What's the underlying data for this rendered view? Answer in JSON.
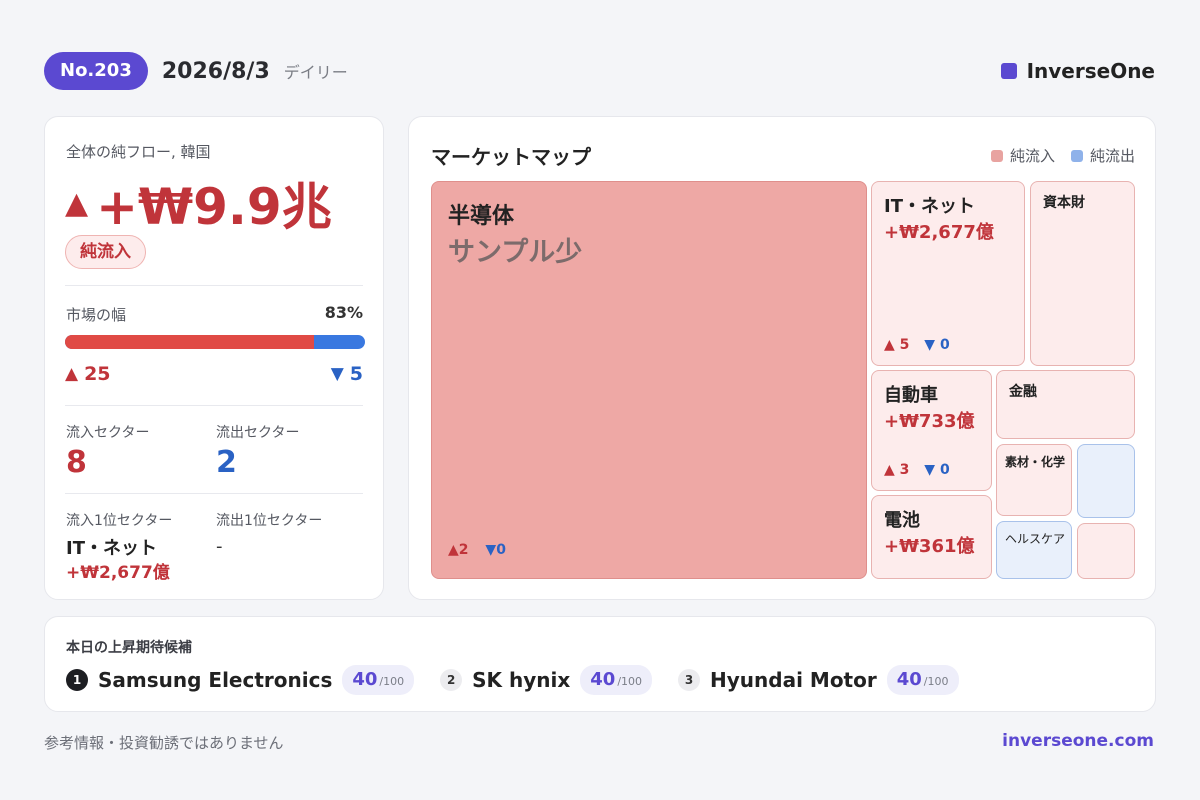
{
  "header": {
    "issue": "No.203",
    "date": "2026/8/3",
    "kind": "デイリー",
    "brand": "InverseOne",
    "brand_color": "#5b49d1"
  },
  "summary": {
    "flow_label": "全体の純フロー, 韓国",
    "flow_value": "+₩9.9兆",
    "flow_arrow": "▲",
    "flow_status": "純流入",
    "breadth_label": "市場の幅",
    "breadth_pct": "83%",
    "breadth_fraction": 0.83,
    "up_count": "25",
    "down_count": "5",
    "inflow_sectors_label": "流入セクター",
    "inflow_sectors": "8",
    "outflow_sectors_label": "流出セクター",
    "outflow_sectors": "2",
    "top_inflow_label": "流入1位セクター",
    "top_inflow_name": "IT・ネット",
    "top_inflow_value": "+₩2,677億",
    "top_outflow_label": "流出1位セクター",
    "top_outflow_name": "-"
  },
  "market_map": {
    "title": "マーケットマップ",
    "legend_inflow": "純流入",
    "legend_outflow": "純流出",
    "inflow_color": "#e8a3a0",
    "outflow_color": "#8fb2ea",
    "tiles": {
      "semis": {
        "name": "半導体",
        "note": "サンプル少",
        "up": "2",
        "down": "0"
      },
      "it": {
        "name": "IT・ネット",
        "value": "+₩2,677億",
        "up": "5",
        "down": "0"
      },
      "capital": {
        "name": "資本財"
      },
      "auto": {
        "name": "自動車",
        "value": "+₩733億",
        "up": "3",
        "down": "0"
      },
      "finance": {
        "name": "金融"
      },
      "battery": {
        "name": "電池",
        "value": "+₩361億"
      },
      "materials": {
        "name": "素材・化学"
      },
      "health": {
        "name": "ヘルスケア"
      }
    }
  },
  "candidates": {
    "title": "本日の上昇期待候補",
    "denom": "/100",
    "items": [
      {
        "rank": "1",
        "name": "Samsung Electronics",
        "score": "40"
      },
      {
        "rank": "2",
        "name": "SK hynix",
        "score": "40"
      },
      {
        "rank": "3",
        "name": "Hyundai Motor",
        "score": "40"
      }
    ]
  },
  "footer": {
    "disclaimer": "参考情報・投資勧誘ではありません",
    "site": "inverseone.com"
  }
}
